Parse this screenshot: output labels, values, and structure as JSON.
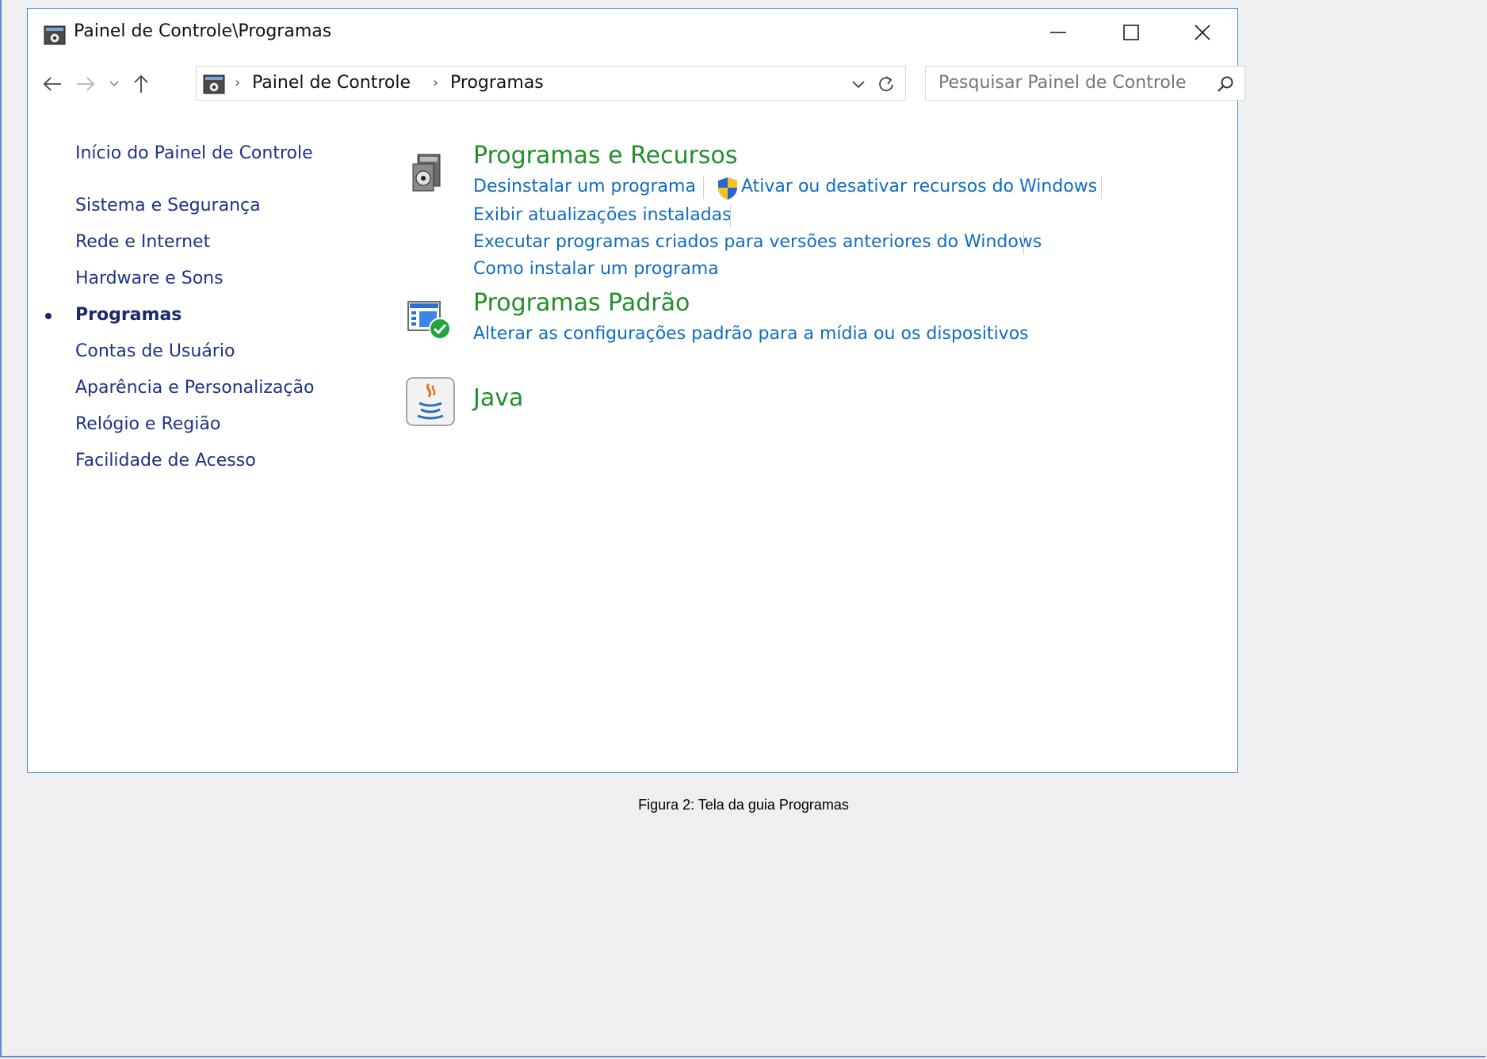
{
  "window": {
    "title": "Painel de Controle\\Programas",
    "controls": {
      "minimize": "—",
      "maximize": "☐",
      "close": "✕"
    }
  },
  "nav": {
    "breadcrumb": [
      "Painel de Controle",
      "Programas"
    ],
    "separator": "›",
    "search_placeholder": "Pesquisar Painel de Controle"
  },
  "sidebar": {
    "home": "Início do Painel de Controle",
    "items": [
      {
        "label": "Sistema e Segurança"
      },
      {
        "label": "Rede e Internet"
      },
      {
        "label": "Hardware e Sons"
      },
      {
        "label": "Programas",
        "current": true
      },
      {
        "label": "Contas de Usuário"
      },
      {
        "label": "Aparência e Personalização"
      },
      {
        "label": "Relógio e Região"
      },
      {
        "label": "Facilidade de Acesso"
      }
    ]
  },
  "categories": [
    {
      "title": "Programas e Recursos",
      "icon": "programs-features-icon",
      "links": [
        "Desinstalar um programa",
        "Ativar ou desativar recursos do Windows",
        "Exibir atualizações instaladas",
        "Executar programas criados para versões anteriores do Windows",
        "Como instalar um programa"
      ]
    },
    {
      "title": "Programas Padrão",
      "icon": "default-programs-icon",
      "links": [
        "Alterar as configurações padrão para a mídia ou os dispositivos"
      ]
    },
    {
      "title": "Java",
      "icon": "java-icon",
      "links": []
    }
  ],
  "caption": "Figura 2: Tela da guia Programas",
  "colors": {
    "category_title": "#1f9028",
    "task_link": "#0e6cc4",
    "sidebar_link": "#1e3287",
    "window_border": "#3d8ee0",
    "page_background": "#efefef"
  }
}
